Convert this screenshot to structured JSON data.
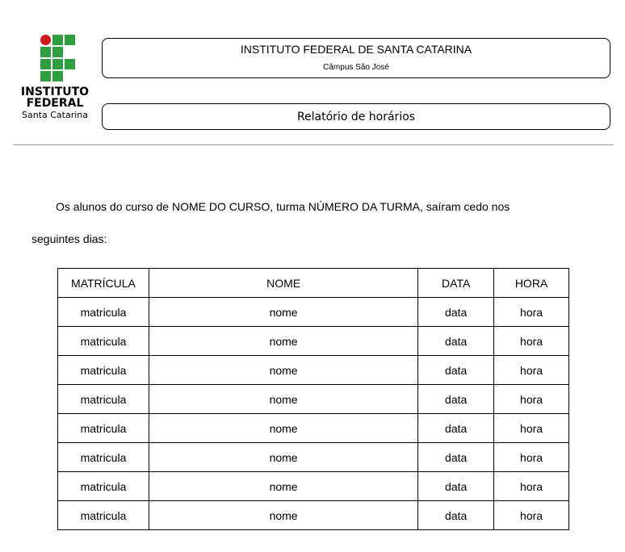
{
  "header": {
    "logo": {
      "line1": "INSTITUTO",
      "line2": "FEDERAL",
      "line3": "Santa Catarina",
      "colors": {
        "green": "#2f9e41",
        "red": "#cd191e"
      }
    },
    "institution": "INSTITUTO FEDERAL DE SANTA CATARINA",
    "campus": "Câmpus São José",
    "report_title": "Relatório de horários"
  },
  "body": {
    "intro_line1": "Os alunos do curso de NOME DO CURSO, turma NÚMERO DA TURMA, saíram cedo nos",
    "intro_line2": "seguintes dias:"
  },
  "table": {
    "headers": [
      "MATRÍCULA",
      "NOME",
      "DATA",
      "HORA"
    ],
    "rows": [
      [
        "matricula",
        "nome",
        "data",
        "hora"
      ],
      [
        "matricula",
        "nome",
        "data",
        "hora"
      ],
      [
        "matricula",
        "nome",
        "data",
        "hora"
      ],
      [
        "matricula",
        "nome",
        "data",
        "hora"
      ],
      [
        "matricula",
        "nome",
        "data",
        "hora"
      ],
      [
        "matricula",
        "nome",
        "data",
        "hora"
      ],
      [
        "matricula",
        "nome",
        "data",
        "hora"
      ],
      [
        "matricula",
        "nome",
        "data",
        "hora"
      ]
    ]
  }
}
